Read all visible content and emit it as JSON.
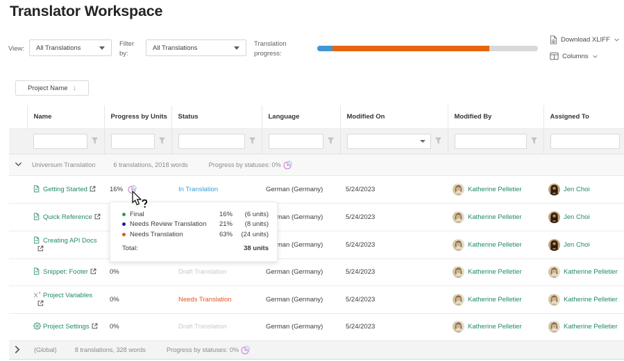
{
  "page": {
    "title": "Translator Workspace"
  },
  "toolbar": {
    "view_label": "View:",
    "view_value": "All Translations",
    "filter_label_1": "Filter",
    "filter_label_2": "by:",
    "filter_value": "All Translations",
    "progress_label_1": "Translation",
    "progress_label_2": "progress:",
    "progress_segments": [
      {
        "name": "final",
        "color": "#4296d2",
        "pct": 7
      },
      {
        "name": "in-progress",
        "color": "#e8650f",
        "pct": 71
      },
      {
        "name": "remaining",
        "color": "#d9d9d9",
        "pct": 22
      }
    ],
    "download_label": "Download XLIFF",
    "columns_label": "Columns"
  },
  "grouping": {
    "chip_label": "Project Name",
    "chip_arrow": "↓"
  },
  "grid": {
    "columns": {
      "name": "Name",
      "progress": "Progress by Units",
      "status": "Status",
      "language": "Language",
      "modified_on": "Modified On",
      "modified_by": "Modified By",
      "assigned_to": "Assigned To"
    },
    "groups": [
      {
        "name": "Universum Translation",
        "summary": "6 translations, 2018 words",
        "progress": "Progress by statuses: 0%"
      },
      {
        "name": "(Global)",
        "summary": "8 translations, 328 words",
        "progress": "Progress by statuses: 0%"
      }
    ],
    "rows": [
      {
        "name": "Getting Started",
        "progress": "16%",
        "status": "In Translation",
        "language": "German (Germany)",
        "modified_on": "5/24/2023",
        "modified_by": "Katherine Pelletier",
        "assigned_to": "Jen Choi"
      },
      {
        "name": "Quick Reference",
        "progress": "",
        "status": "",
        "language": "German (Germany)",
        "modified_on": "5/24/2023",
        "modified_by": "Katherine Pelletier",
        "assigned_to": "Jen Choi"
      },
      {
        "name": "Creating API Docs",
        "progress": "",
        "status": "",
        "language": "German (Germany)",
        "modified_on": "5/24/2023",
        "modified_by": "Katherine Pelletier",
        "assigned_to": "Jen Choi"
      },
      {
        "name": "Snippet: Footer",
        "progress": "0%",
        "status": "Draft Translation",
        "language": "German (Germany)",
        "modified_on": "5/24/2023",
        "modified_by": "Katherine Pelletier",
        "assigned_to": "Katherine Pelletier"
      },
      {
        "name": "Project Variables",
        "progress": "0%",
        "status": "Needs Translation",
        "language": "German (Germany)",
        "modified_on": "5/24/2023",
        "modified_by": "Katherine Pelletier",
        "assigned_to": "Katherine Pelletier"
      },
      {
        "name": "Project Settings",
        "progress": "0%",
        "status": "Draft Translation",
        "language": "German (Germany)",
        "modified_on": "5/24/2023",
        "modified_by": "Katherine Pelletier",
        "assigned_to": "Katherine Pelletier"
      }
    ]
  },
  "tooltip": {
    "rows": [
      {
        "label": "Final",
        "pct": "16%",
        "units": "(6 units)",
        "dot_color": "#2e9e4f"
      },
      {
        "label": "Needs Review Translation",
        "pct": "21%",
        "units": "(8 units)",
        "dot_color": "#1a1aa8"
      },
      {
        "label": "Needs Translation",
        "pct": "63%",
        "units": "(24 units)",
        "dot_color": "#e0571f"
      }
    ],
    "total_label": "Total:",
    "total_value": "38 units"
  }
}
